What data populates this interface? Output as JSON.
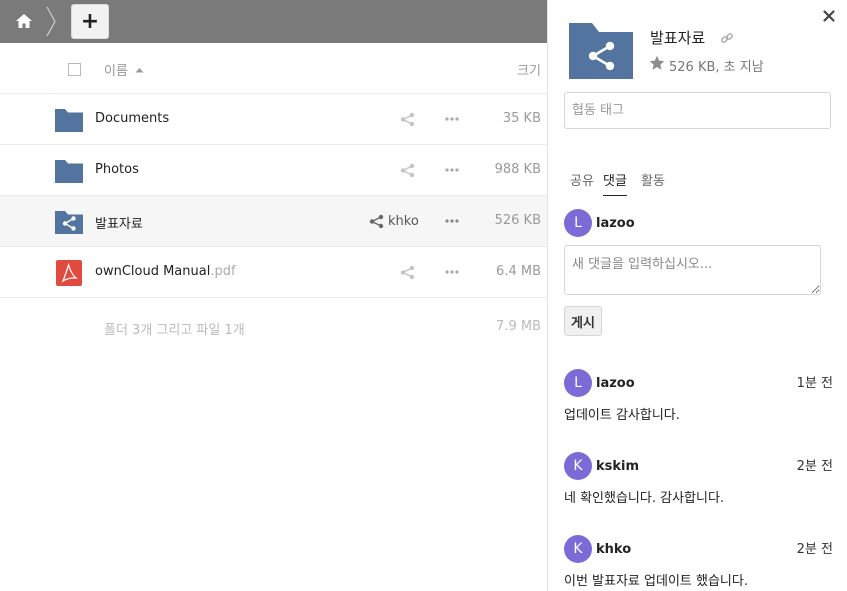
{
  "header": {
    "add_label": "+"
  },
  "columns": {
    "name": "이름",
    "size": "크기"
  },
  "files": [
    {
      "name": "Documents",
      "ext": "",
      "size": "35 KB",
      "type": "folder",
      "share": ""
    },
    {
      "name": "Photos",
      "ext": "",
      "size": "988 KB",
      "type": "folder",
      "share": ""
    },
    {
      "name": "발표자료",
      "ext": "",
      "size": "526 KB",
      "type": "shared-folder",
      "share": "khko"
    },
    {
      "name": "ownCloud Manual",
      "ext": ".pdf",
      "size": "6.4 MB",
      "type": "pdf",
      "share": ""
    }
  ],
  "summary": {
    "text": "폴더 3개 그리고 파일 1개",
    "size": "7.9 MB"
  },
  "details": {
    "title": "발표자료",
    "meta": "526 KB, 초 지남",
    "tag_placeholder": "협동 태그",
    "tabs": [
      "공유",
      "댓글",
      "활동"
    ],
    "current_user": {
      "initial": "L",
      "name": "lazoo"
    },
    "comment_placeholder": "새 댓글을 입력하십시오...",
    "post_label": "게시",
    "comments": [
      {
        "initial": "L",
        "author": "lazoo",
        "time": "1분 전",
        "text": "업데이트 감사합니다."
      },
      {
        "initial": "K",
        "author": "kskim",
        "time": "2분 전",
        "text": "네 확인했습니다. 감사합니다."
      },
      {
        "initial": "K",
        "author": "khko",
        "time": "2분 전",
        "text": "이번 발표자료 업데이트 했습니다."
      }
    ]
  },
  "colors": {
    "topbar": "#7a7a7a",
    "folder": "#52749f",
    "pdf": "#e04a3f",
    "avatar": "#7c6ad6"
  },
  "icons": [
    "home-icon",
    "add-icon",
    "sort-asc-icon",
    "folder-icon",
    "shared-folder-icon",
    "pdf-icon",
    "share-icon",
    "more-icon",
    "close-icon",
    "link-icon",
    "star-icon"
  ]
}
